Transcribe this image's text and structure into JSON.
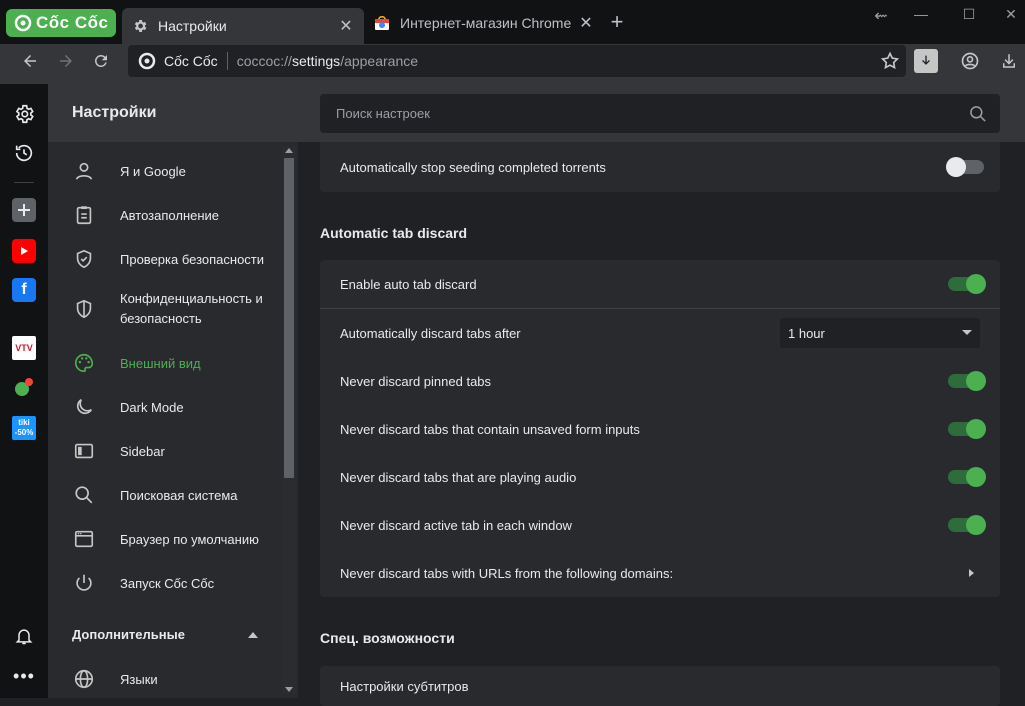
{
  "browser": {
    "logo_text": "Cốc Cốc",
    "tabs": [
      {
        "title": "Настройки",
        "icon": "gear-icon",
        "active": true
      },
      {
        "title": "Интернет-магазин Chrome",
        "icon": "chrome-webstore-icon",
        "active": false
      }
    ],
    "omnibox": {
      "site_name": "Cốc Cốc",
      "url_scheme": "coccoc://",
      "url_host": "settings",
      "url_path": "/appearance"
    }
  },
  "settings": {
    "title": "Настройки",
    "search_placeholder": "Поиск настроек",
    "menu": [
      {
        "label": "Я и Google",
        "icon": "person-icon"
      },
      {
        "label": "Автозаполнение",
        "icon": "clipboard-icon"
      },
      {
        "label": "Проверка безопасности",
        "icon": "shield-check-icon"
      },
      {
        "label": "Конфиденциальность и безопасность",
        "icon": "shield-icon"
      },
      {
        "label": "Внешний вид",
        "icon": "palette-icon",
        "selected": true
      },
      {
        "label": "Dark Mode",
        "icon": "moon-icon"
      },
      {
        "label": "Sidebar",
        "icon": "sidebar-icon"
      },
      {
        "label": "Поисковая система",
        "icon": "search-icon"
      },
      {
        "label": "Браузер по умолчанию",
        "icon": "browser-window-icon"
      },
      {
        "label": "Запуск Cốc Cốc",
        "icon": "power-icon"
      }
    ],
    "advanced_label": "Дополнительные",
    "languages_label": "Языки"
  },
  "content": {
    "torrent_row": {
      "label": "Automatically stop seeding completed torrents",
      "enabled": false
    },
    "tab_discard": {
      "title": "Automatic tab discard",
      "enable": {
        "label": "Enable auto tab discard",
        "enabled": true
      },
      "discard_after": {
        "label": "Automatically discard tabs after",
        "value": "1 hour"
      },
      "pinned": {
        "label": "Never discard pinned tabs",
        "enabled": true
      },
      "unsaved_forms": {
        "label": "Never discard tabs that contain unsaved form inputs",
        "enabled": true
      },
      "audio": {
        "label": "Never discard tabs that are playing audio",
        "enabled": true
      },
      "active": {
        "label": "Never discard active tab in each window",
        "enabled": true
      },
      "domains": {
        "label": "Never discard tabs with URLs from the following domains:"
      }
    },
    "accessibility": {
      "title": "Спец. возможности",
      "subtitles_label": "Настройки субтитров"
    }
  },
  "sidebar_apps": [
    {
      "name": "settings-icon"
    },
    {
      "name": "history-icon"
    },
    {
      "name": "add-icon"
    },
    {
      "name": "youtube-icon"
    },
    {
      "name": "facebook-icon"
    },
    {
      "name": "vtv-go-icon",
      "text": "VTV"
    },
    {
      "name": "game-icon"
    },
    {
      "name": "tiki-icon",
      "text": "tiki",
      "badge": "-50%"
    },
    {
      "name": "bell-icon"
    },
    {
      "name": "more-icon"
    }
  ],
  "colors": {
    "accent": "#4caf50",
    "background": "#202124",
    "card": "#292a2d"
  }
}
